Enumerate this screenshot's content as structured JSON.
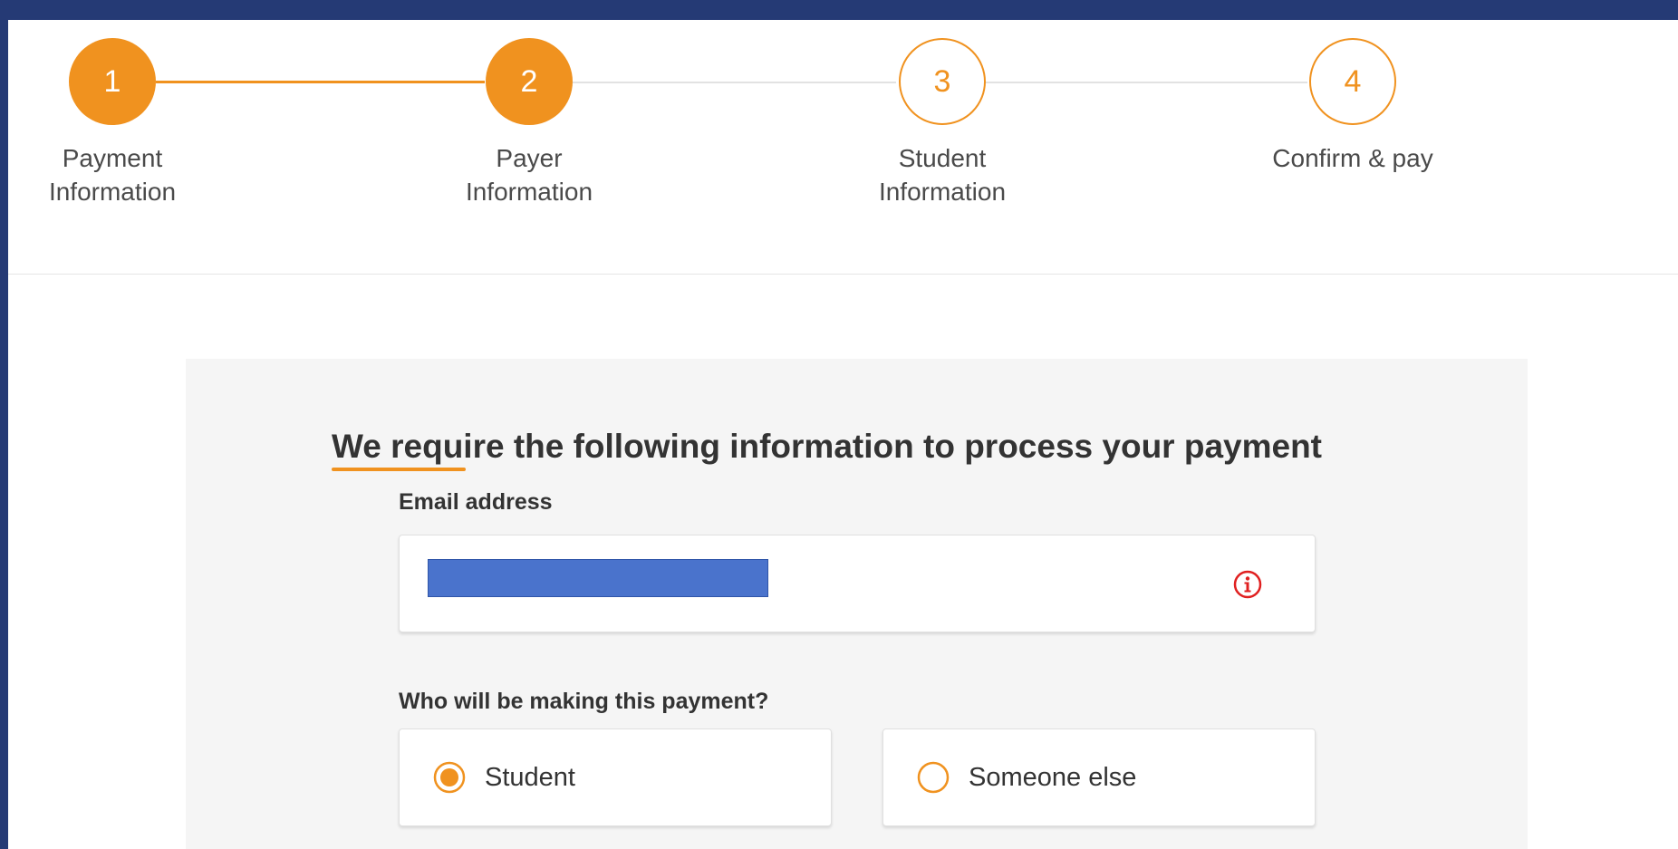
{
  "stepper": {
    "steps": [
      {
        "number": "1",
        "label": "Payment\nInformation",
        "state": "completed"
      },
      {
        "number": "2",
        "label": "Payer\nInformation",
        "state": "current"
      },
      {
        "number": "3",
        "label": "Student\nInformation",
        "state": "pending"
      },
      {
        "number": "4",
        "label": "Confirm & pay",
        "state": "pending"
      }
    ]
  },
  "form": {
    "heading": "We require the following information to process your payment",
    "email": {
      "label": "Email address",
      "value": "",
      "status_icon": "info-icon"
    },
    "payer": {
      "label": "Who will be making this payment?",
      "options": [
        {
          "label": "Student",
          "selected": true
        },
        {
          "label": "Someone else",
          "selected": false
        }
      ]
    }
  },
  "colors": {
    "accent": "#f0921f",
    "frame": "#253a75",
    "error": "#e02020",
    "redaction": "#4a73cc"
  }
}
